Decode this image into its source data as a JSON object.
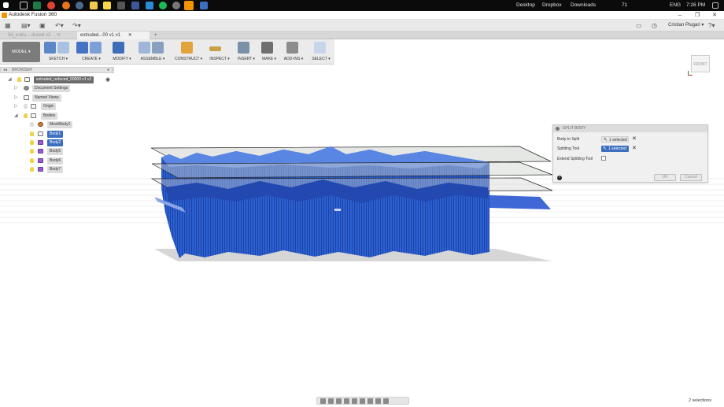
{
  "taskbar": {
    "right": {
      "desktop": "Desktop",
      "dropbox": "Dropbox",
      "downloads": "Downloads",
      "temp": "71",
      "lang": "ENG",
      "time": "7:26 PM"
    }
  },
  "window": {
    "title": "Autodesk Fusion 360"
  },
  "appbar": {
    "user": "Cristian Plugari"
  },
  "tabs": [
    {
      "label": "3d_extru... duced v2"
    },
    {
      "label": "extruded...00 v1 v1"
    }
  ],
  "ribbon": {
    "workspace": "MODEL",
    "groups": [
      {
        "label": "SKETCH"
      },
      {
        "label": "CREATE"
      },
      {
        "label": "MODIFY"
      },
      {
        "label": "ASSEMBLE"
      },
      {
        "label": "CONSTRUCT"
      },
      {
        "label": "INSPECT"
      },
      {
        "label": "INSERT"
      },
      {
        "label": "MAKE"
      },
      {
        "label": "ADD-INS"
      },
      {
        "label": "SELECT"
      }
    ]
  },
  "browser": {
    "title": "BROWSER",
    "root": "extruded_reduced_50000 v1 v1",
    "items": [
      {
        "label": "Document Settings"
      },
      {
        "label": "Named Views"
      },
      {
        "label": "Origin"
      },
      {
        "label": "Bodies"
      }
    ],
    "bodies": [
      {
        "label": "MeshBody1"
      },
      {
        "label": "Body1"
      },
      {
        "label": "Body2"
      },
      {
        "label": "Body5"
      },
      {
        "label": "Body6"
      },
      {
        "label": "Body7"
      }
    ]
  },
  "dialog": {
    "title": "SPLIT BODY",
    "body_to_split_label": "Body to Split",
    "body_to_split_value": "1 selected",
    "splitting_tool_label": "Splitting Tool",
    "splitting_tool_value": "1 selected",
    "extend_label": "Extend Splitting Tool",
    "ok": "OK",
    "cancel": "Cancel"
  },
  "viewcube": {
    "face": "FRONT"
  },
  "status": {
    "selections": "2 selections"
  }
}
